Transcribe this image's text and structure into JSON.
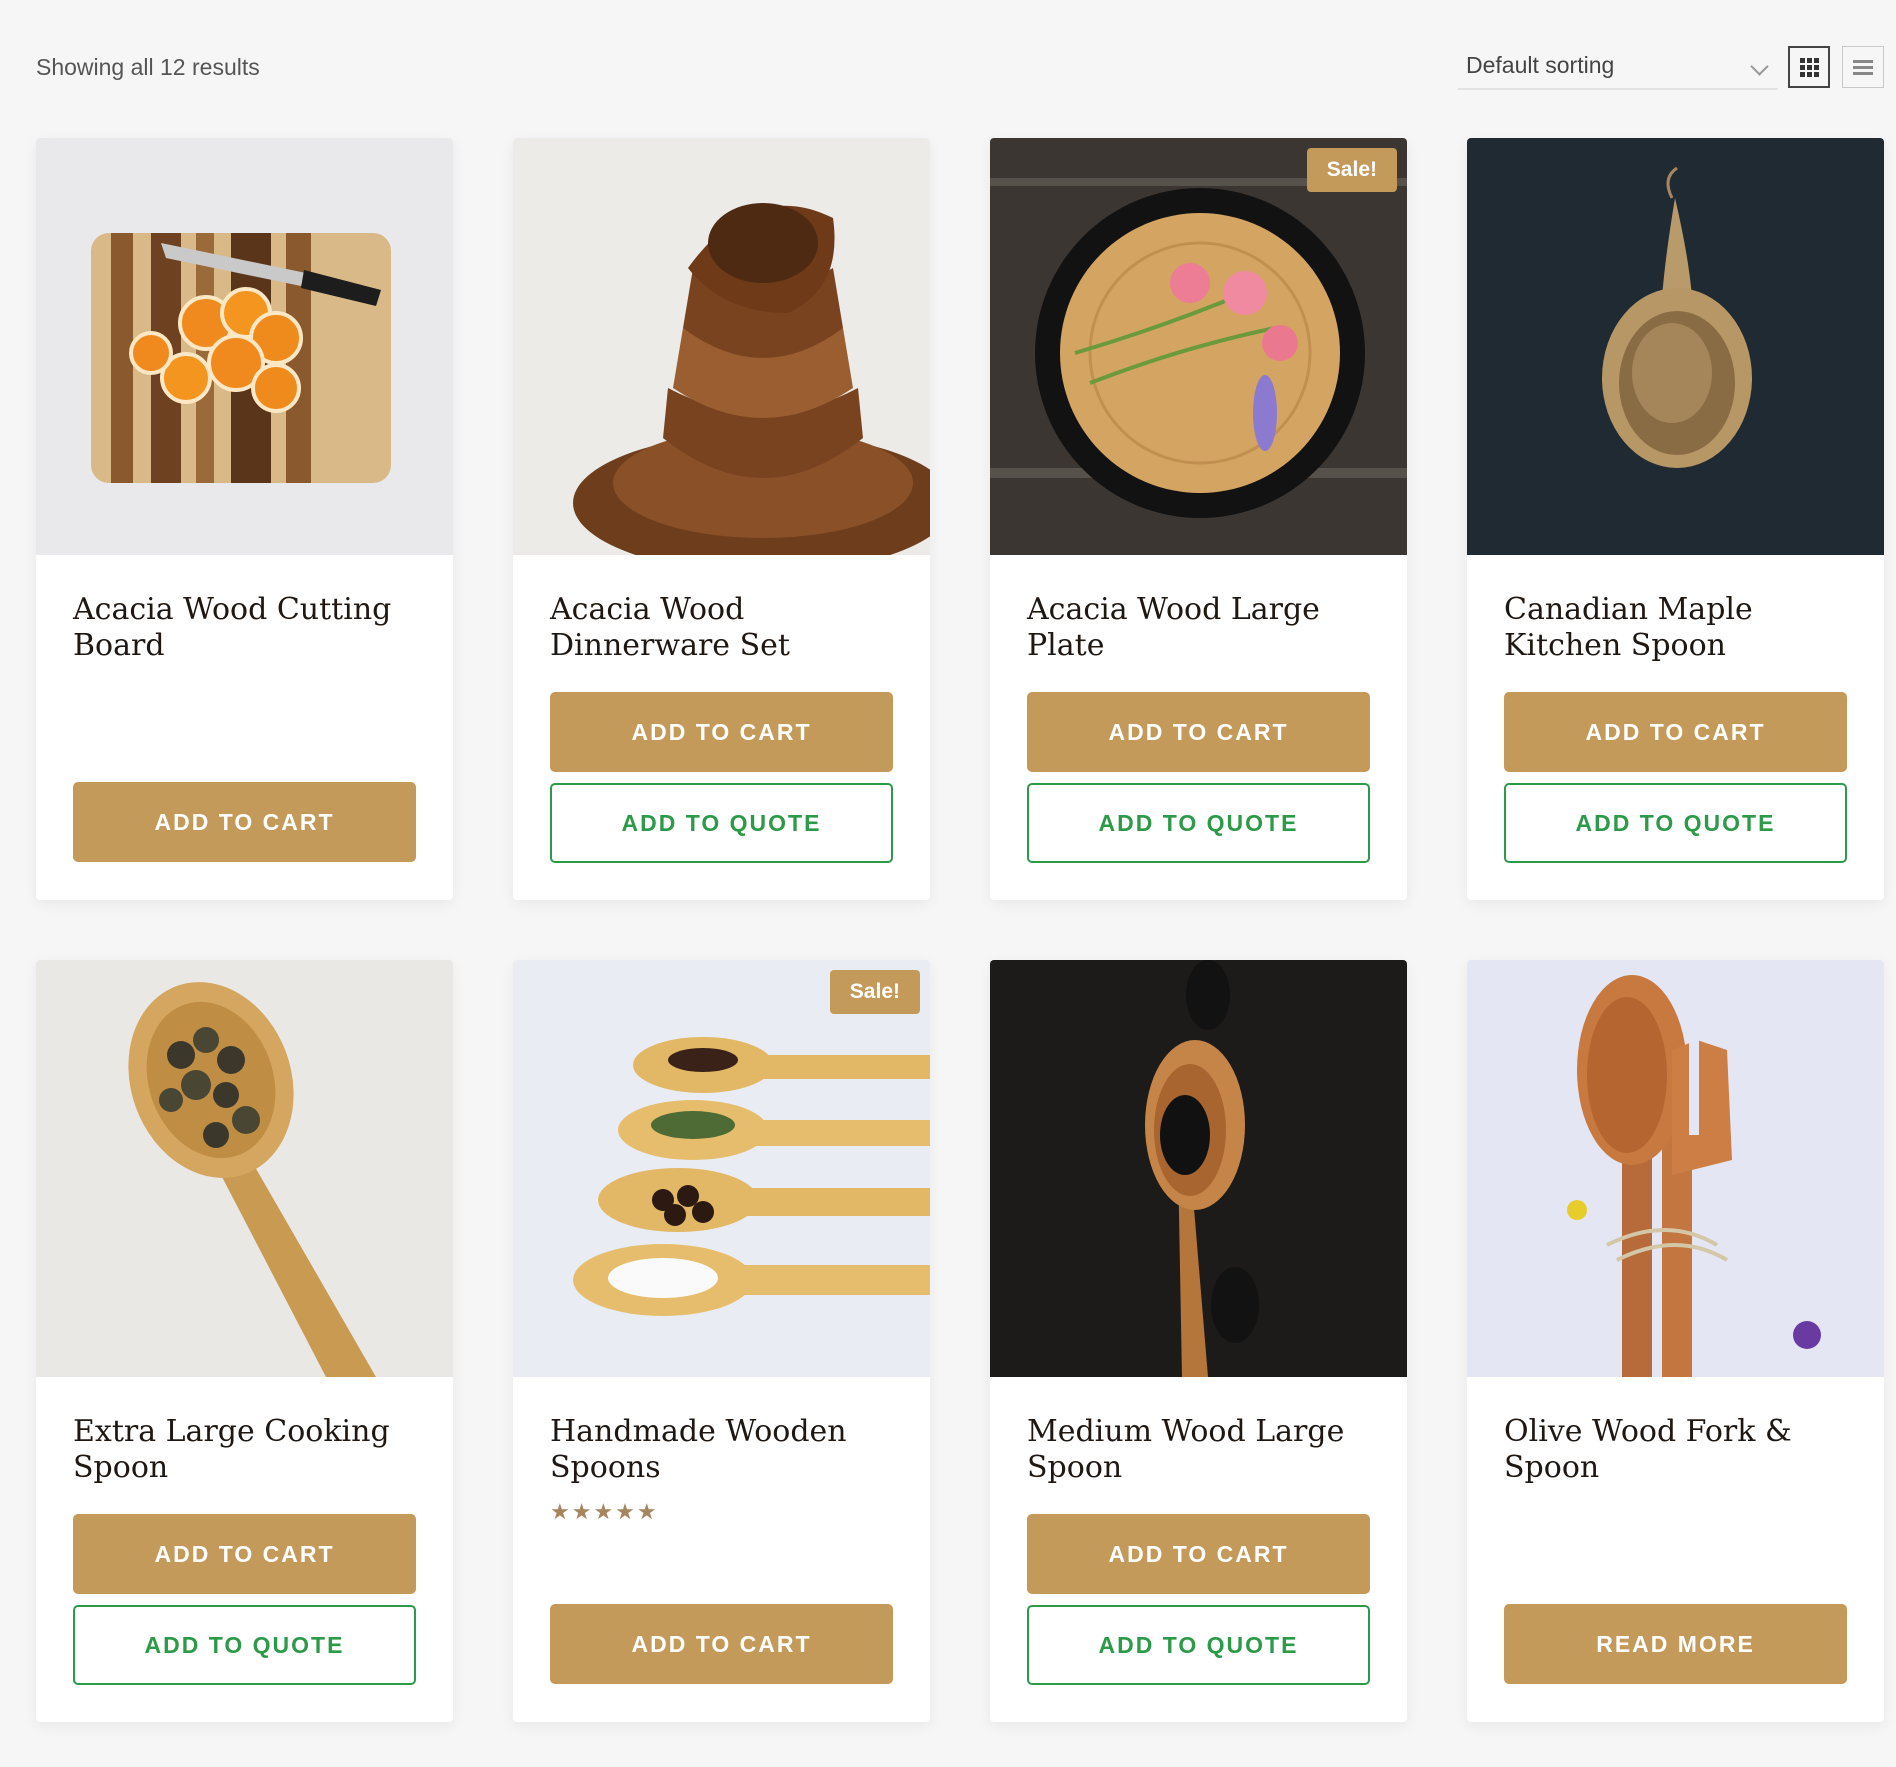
{
  "toolbar": {
    "result_count": "Showing all 12 results",
    "sorting": "Default sorting"
  },
  "products": [
    {
      "name": "Acacia Wood Cutting Board",
      "cart": "ADD TO CART"
    },
    {
      "name": "Acacia Wood Dinnerware Set",
      "cart": "ADD TO CART",
      "quote": "ADD TO QUOTE"
    },
    {
      "name": "Acacia Wood Large Plate",
      "sale": "Sale!",
      "cart": "ADD TO CART",
      "quote": "ADD TO QUOTE"
    },
    {
      "name": "Canadian Maple Kitchen Spoon",
      "cart": "ADD TO CART",
      "quote": "ADD TO QUOTE"
    },
    {
      "name": "Extra Large Cooking Spoon",
      "cart": "ADD TO CART",
      "quote": "ADD TO QUOTE"
    },
    {
      "name": "Handmade Wooden Spoons",
      "sale": "Sale!",
      "rating": "★★★★★",
      "cart": "ADD TO CART"
    },
    {
      "name": "Medium Wood Large Spoon",
      "cart": "ADD TO CART",
      "quote": "ADD TO QUOTE"
    },
    {
      "name": "Olive Wood Fork & Spoon",
      "cart": "READ MORE"
    }
  ],
  "colors": {
    "accent": "#c49a5b",
    "quote_green": "#2c9a49",
    "background": "#f6f6f6"
  }
}
